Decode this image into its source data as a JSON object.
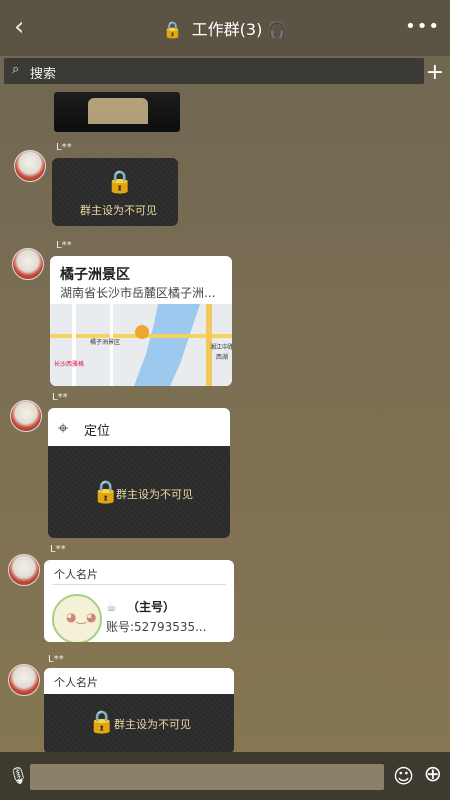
{
  "header": {
    "title": "工作群(3)",
    "back_icon": "back-icon",
    "more_icon": "more-icon"
  },
  "search": {
    "label": "搜索"
  },
  "messages": [
    {
      "sender": "L**",
      "type": "hidden",
      "text": "群主设为不可见"
    },
    {
      "sender": "L**",
      "type": "location",
      "title": "橘子洲景区",
      "address": "湖南省长沙市岳麓区橘子洲...",
      "map_labels": [
        "橘子洲景区",
        "长沙西雅格",
        "湘江中路",
        "西湖"
      ]
    },
    {
      "sender": "L**",
      "type": "location-hidden",
      "label": "定位",
      "text": "群主设为不可见"
    },
    {
      "sender": "L**",
      "type": "contact-card",
      "label": "个人名片",
      "name": "（主号）",
      "account": "账号:52793535..."
    },
    {
      "sender": "L**",
      "type": "contact-hidden",
      "label": "个人名片",
      "text": "群主设为不可见"
    }
  ],
  "bottom": {
    "mic_icon": "mic-icon",
    "emoji_icon": "emoji-icon",
    "plus_icon": "plus-icon"
  }
}
